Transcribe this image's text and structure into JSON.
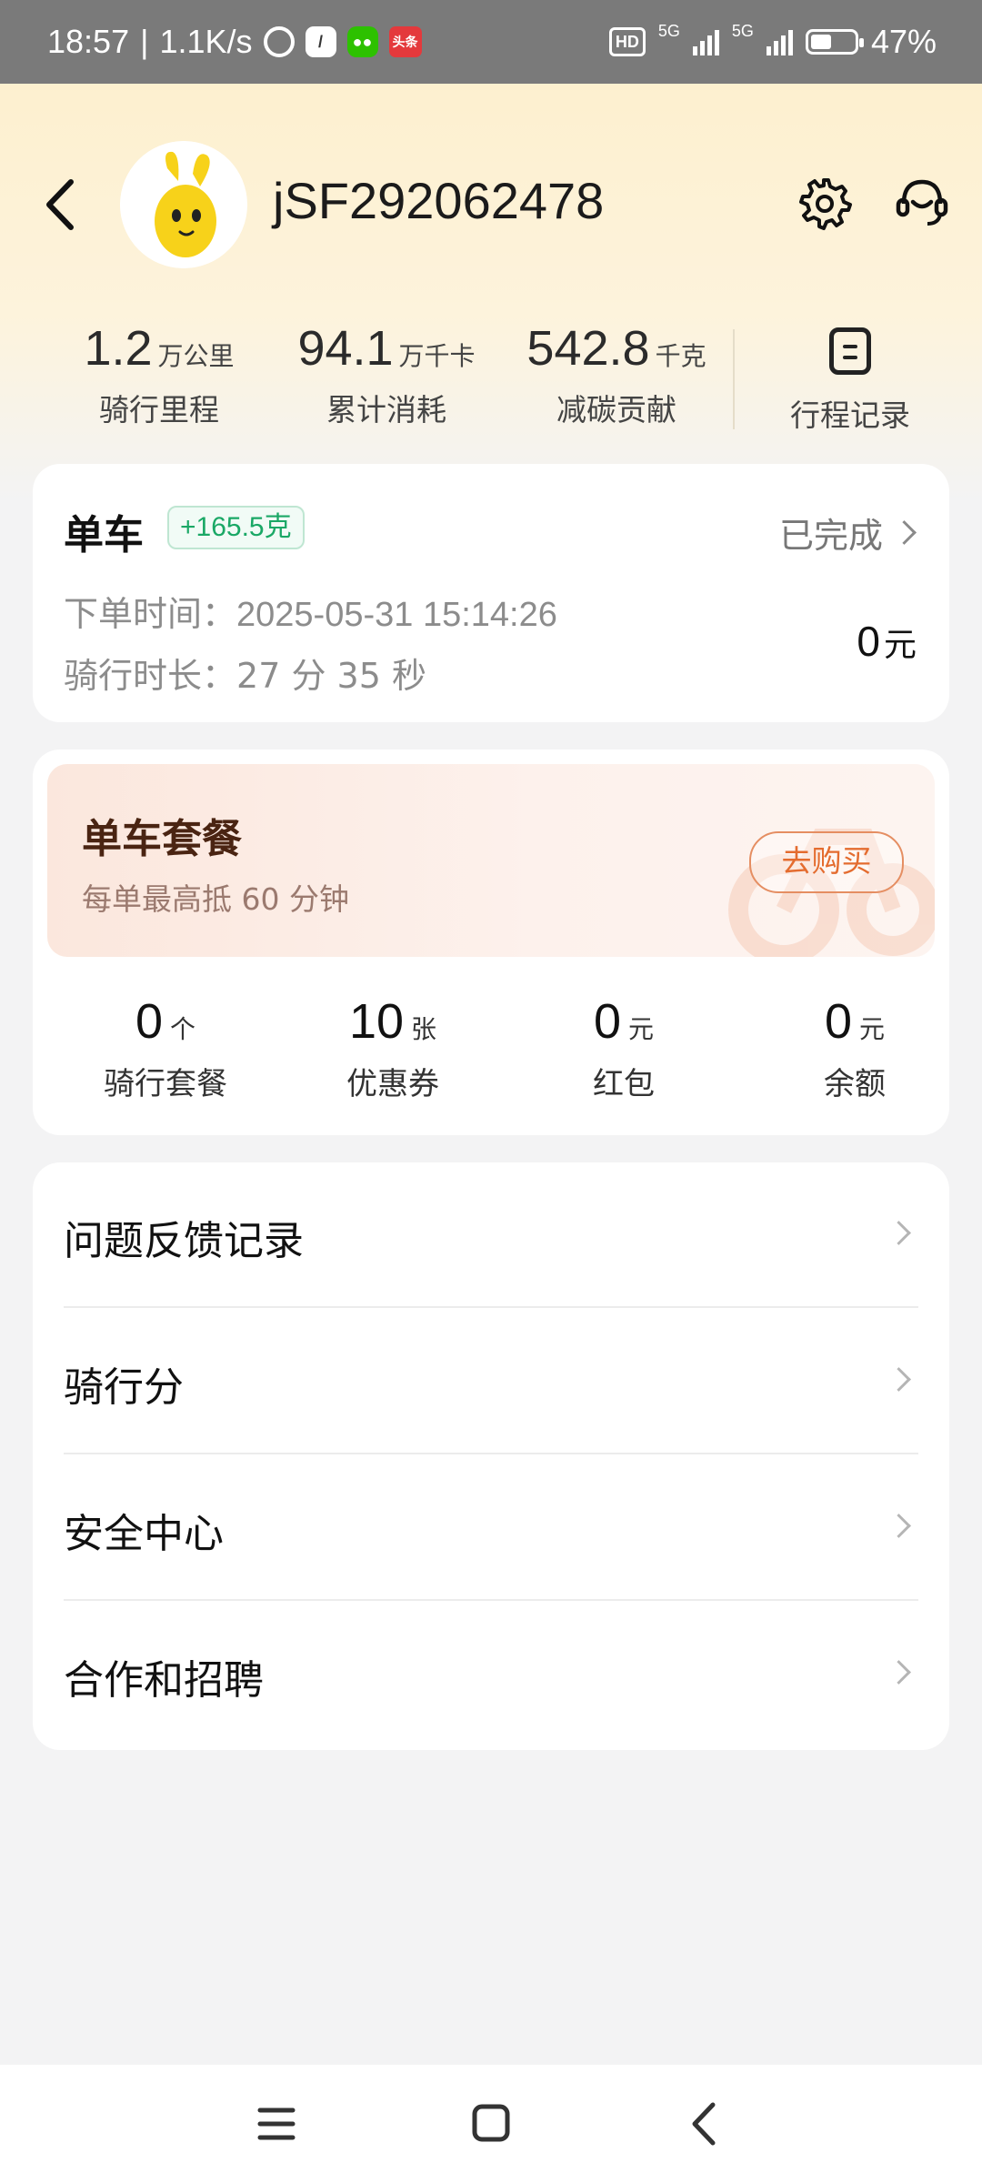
{
  "status_bar": {
    "time": "18:57",
    "speed": "1.1K/s",
    "left_icons": [
      "alarm-icon",
      "app-icon",
      "wechat-icon",
      "toutiao-icon"
    ],
    "toutiao_text": "头条",
    "hd_badge": "HD",
    "network_1": "5G",
    "network_2": "5G",
    "battery_percent": "47%",
    "battery_level": 0.47
  },
  "header": {
    "username": "jSF292062478",
    "icons": [
      "back-icon",
      "settings-icon",
      "customer-service-icon"
    ]
  },
  "stats": [
    {
      "value": "1.2",
      "unit": "万公里",
      "label": "骑行里程"
    },
    {
      "value": "94.1",
      "unit": "万千卡",
      "label": "累计消耗"
    },
    {
      "value": "542.8",
      "unit": "千克",
      "label": "减碳贡献"
    }
  ],
  "trip_record": {
    "label": "行程记录",
    "icon": "document-list-icon"
  },
  "order": {
    "title": "单车",
    "carbon_badge": "+165.5克",
    "status": "已完成",
    "order_time_label": "下单时间：",
    "order_time": "2025-05-31 15:14:26",
    "duration_label": "骑行时长：",
    "duration": "27 分 35 秒",
    "price": "0",
    "price_unit": "元"
  },
  "package": {
    "title": "单车套餐",
    "subtitle": "每单最高抵 60 分钟",
    "buy_label": "去购买",
    "stats": [
      {
        "value": "0",
        "unit": "个",
        "label": "骑行套餐"
      },
      {
        "value": "10",
        "unit": "张",
        "label": "优惠券"
      },
      {
        "value": "0",
        "unit": "元",
        "label": "红包"
      },
      {
        "value": "0",
        "unit": "元",
        "label": "余额"
      }
    ]
  },
  "menu": [
    {
      "label": "问题反馈记录"
    },
    {
      "label": "骑行分"
    },
    {
      "label": "安全中心"
    },
    {
      "label": "合作和招聘"
    }
  ],
  "nav_bar": {
    "icons": [
      "menu-icon",
      "home-icon",
      "back-icon"
    ]
  },
  "colors": {
    "accent_orange": "#e46c2f",
    "carbon_green": "#1aa866",
    "header_gradient": "#fdf0cf"
  }
}
